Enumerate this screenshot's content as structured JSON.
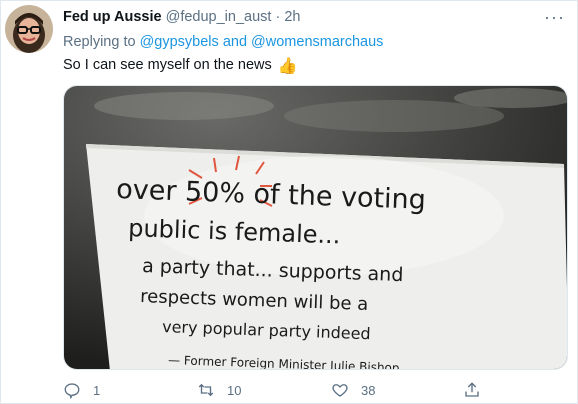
{
  "tweet": {
    "author_name": "Fed up Aussie",
    "author_handle": "@fedup_in_aust",
    "separator": "·",
    "time": "2h",
    "more_label": "···",
    "replying_prefix": "Replying to",
    "replying_to": [
      "@gypsybels",
      "and",
      "@womensmarchaus"
    ],
    "text": "So I can see myself on the news",
    "emoji": "👍"
  },
  "media": {
    "sign_lines": [
      "over 50% of the voting",
      "public is female...",
      "a party that... supports and",
      "respects women will be a",
      "very popular party indeed",
      "— Former Foreign Minister Julie Bishop"
    ]
  },
  "actions": {
    "reply_count": "1",
    "retweet_count": "10",
    "like_count": "38"
  },
  "colors": {
    "link": "#1b95e0",
    "muted": "#5b7083",
    "text": "#0f1419"
  }
}
